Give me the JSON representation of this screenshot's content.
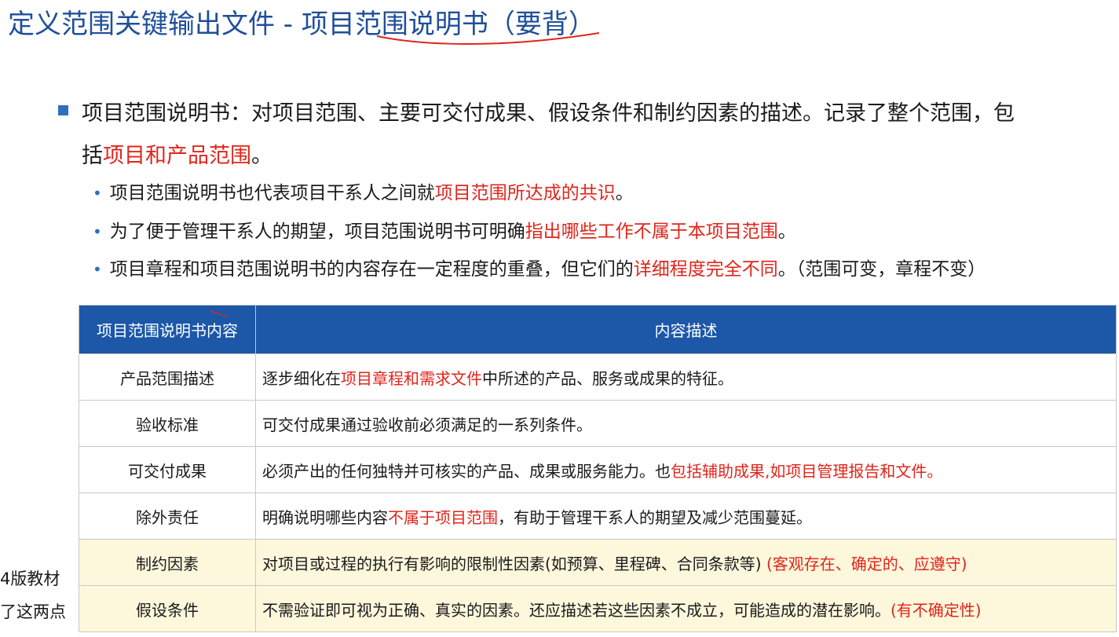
{
  "title": "定义范围关键输出文件 - 项目范围说明书（要背）",
  "main_point": {
    "line1": "项目范围说明书：对项目范围、主要可交付成果、假设条件和制约因素的描述。记录了整个范围，包",
    "line2_prefix": "括",
    "line2_red": "项目和产品范围",
    "line2_suffix": "。"
  },
  "sub_points": [
    {
      "prefix": "项目范围说明书也代表项目干系人之间就",
      "red": "项目范围所达成的共识",
      "suffix": "。"
    },
    {
      "prefix": "为了便于管理干系人的期望，项目范围说明书可明确",
      "red": "指出哪些工作不属于本项目范围",
      "suffix": "。"
    },
    {
      "prefix": "项目章程和项目范围说明书的内容存在一定程度的重叠，但它们的",
      "red": "详细程度完全不同",
      "suffix": "。（范围可变，章程不变）"
    }
  ],
  "table": {
    "headers": [
      "项目范围说明书内容",
      "内容描述"
    ],
    "rows": [
      {
        "name": "产品范围描述",
        "prefix": "逐步细化在",
        "red": "项目章程和需求文件",
        "suffix": "中所述的产品、服务或成果的特征。",
        "highlight": false
      },
      {
        "name": "验收标准",
        "prefix": "可交付成果通过验收前必须满足的一系列条件。",
        "red": "",
        "suffix": "",
        "highlight": false
      },
      {
        "name": "可交付成果",
        "prefix": "必须产出的任何独特并可核实的产品、成果或服务能力。也",
        "red": "包括辅助成果,如项目管理报告和文件。",
        "suffix": "",
        "highlight": false
      },
      {
        "name": "除外责任",
        "prefix": "明确说明哪些内容",
        "red": "不属于项目范围",
        "suffix": "，有助于管理干系人的期望及减少范围蔓延。",
        "highlight": false
      },
      {
        "name": "制约因素",
        "prefix": "对项目或过程的执行有影响的限制性因素(如预算、里程碑、合同条款等) ",
        "red": "(客观存在、确定的、应遵守)",
        "suffix": "",
        "highlight": true
      },
      {
        "name": "假设条件",
        "prefix": "不需验证即可视为正确、真实的因素。还应描述若这些因素不成立，可能造成的潜在影响。",
        "red": "(有不确定性)",
        "suffix": "",
        "highlight": true
      }
    ]
  },
  "side_notes": [
    "4版教材",
    "了这两点"
  ],
  "colors": {
    "title": "#1f4f9a",
    "accent_red": "#e0251b",
    "header_bg": "#1c57a8",
    "highlight_row": "#fdf7dc",
    "bullet": "#2e6fc0"
  }
}
